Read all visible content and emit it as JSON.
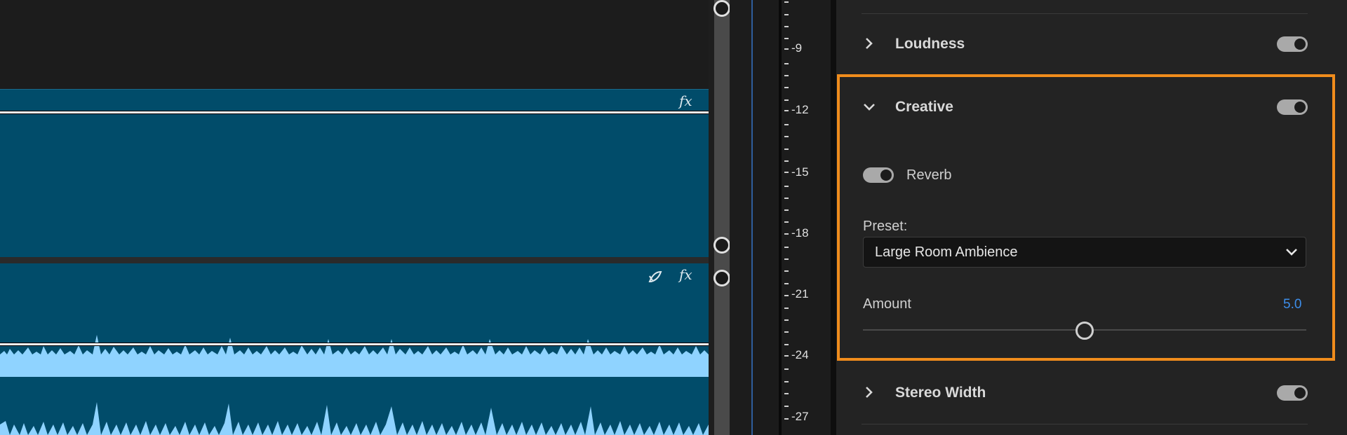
{
  "timeline": {
    "clip_top_fx": "fx",
    "clip_bottom_fx": "fx",
    "colors": {
      "clip": "#014c6a",
      "waveform": "#8fd3ff"
    }
  },
  "meter": {
    "ticks": [
      "-9",
      "-12",
      "-15",
      "-18",
      "-21",
      "-24",
      "-27"
    ]
  },
  "panel": {
    "loudness": {
      "title": "Loudness",
      "enabled": true
    },
    "creative": {
      "title": "Creative",
      "enabled": true,
      "reverb_label": "Reverb",
      "reverb_enabled": true,
      "preset_label": "Preset:",
      "preset_value": "Large Room Ambience",
      "amount_label": "Amount",
      "amount_value": "5.0",
      "highlight_color": "#f08c1c"
    },
    "stereo_width": {
      "title": "Stereo Width",
      "enabled": true
    }
  }
}
